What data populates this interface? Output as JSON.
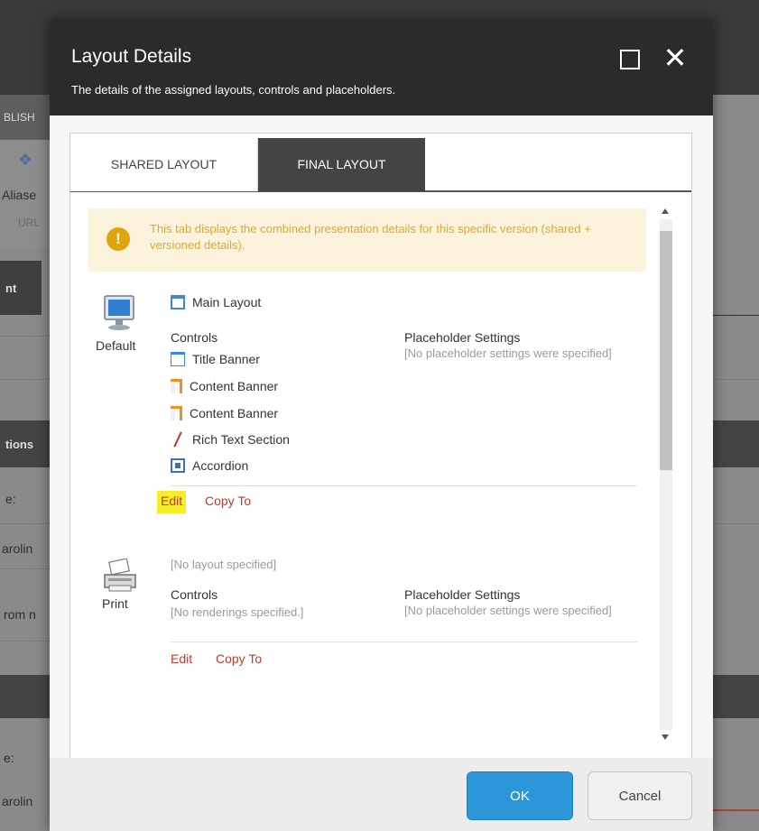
{
  "background": {
    "strip_text": "BLISH",
    "aliases": "Aliase",
    "url": "URL",
    "tab": "nt",
    "options": "tions",
    "field1": "e:",
    "value1": "arolin",
    "from": "rom n",
    "field2": "e:",
    "value2": "arolin"
  },
  "dialog": {
    "title": "Layout Details",
    "subtitle": "The details of the assigned layouts, controls and placeholders.",
    "close_glyph": "✕"
  },
  "tabs": [
    {
      "label": "SHARED LAYOUT",
      "active": false
    },
    {
      "label": "FINAL LAYOUT",
      "active": true
    }
  ],
  "warning": {
    "icon": "!",
    "text": "This tab displays the combined presentation details for this specific version (shared + versioned details)."
  },
  "devices": [
    {
      "name": "Default",
      "icon": "monitor-icon",
      "layout": "Main Layout",
      "controls_label": "Controls",
      "controls": [
        {
          "icon": "title-banner-icon",
          "label": "Title Banner"
        },
        {
          "icon": "content-banner-icon",
          "label": "Content Banner"
        },
        {
          "icon": "content-banner-icon",
          "label": "Content Banner"
        },
        {
          "icon": "rich-text-icon",
          "label": "Rich Text Section"
        },
        {
          "icon": "accordion-icon",
          "label": "Accordion"
        }
      ],
      "placeholder_label": "Placeholder Settings",
      "placeholder_text": "[No placeholder settings were specified]",
      "edit": "Edit",
      "copy_to": "Copy To"
    },
    {
      "name": "Print",
      "icon": "printer-icon",
      "layout": "[No layout specified]",
      "controls_label": "Controls",
      "controls_empty": "[No renderings specified.]",
      "placeholder_label": "Placeholder Settings",
      "placeholder_text": "[No placeholder settings were specified]",
      "edit": "Edit",
      "copy_to": "Copy To"
    }
  ],
  "footer": {
    "ok": "OK",
    "cancel": "Cancel"
  },
  "colors": {
    "header": "#2b2b2b",
    "active_tab": "#444444",
    "link": "#c0392b",
    "warning_bg": "#fcf3dd",
    "warning_icon": "#e0a40e",
    "ok_button": "#2b97d9",
    "highlight": "#f7ee2a"
  }
}
